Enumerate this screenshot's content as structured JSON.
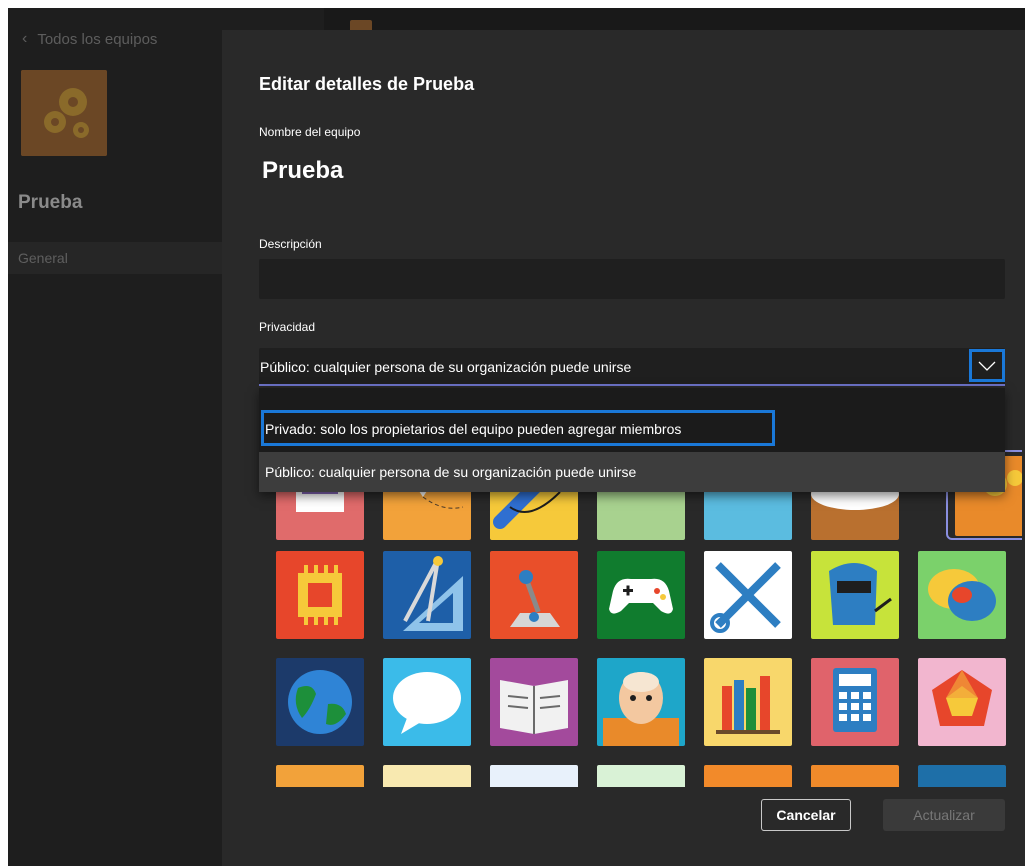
{
  "sidebar": {
    "back_label": "Todos los equipos",
    "team_name": "Prueba",
    "channels": [
      {
        "label": "General"
      }
    ]
  },
  "dialog": {
    "title": "Editar detalles de Prueba",
    "name_label": "Nombre del equipo",
    "team_name": "Prueba",
    "description_label": "Descripción",
    "description_value": "",
    "privacy_label": "Privacidad",
    "privacy_selected": "Público: cualquier persona de su organización puede unirse",
    "privacy_options": [
      {
        "label": "Privado: solo los propietarios del equipo pueden agregar miembros"
      },
      {
        "label": "Público: cualquier persona de su organización puede unirse"
      }
    ],
    "cancel_label": "Cancelar",
    "update_label": "Actualizar"
  },
  "icons": {
    "row1": [
      "photo-frame-icon",
      "paper-plane-icon",
      "link-icon",
      "music-note-icon",
      "art-palette-icon",
      "rocket-launch-icon",
      "gears-icon"
    ],
    "row2": [
      "circuit-chip-icon",
      "compass-ruler-icon",
      "joystick-icon",
      "game-controller-icon",
      "tools-icon",
      "welding-mask-icon",
      "chat-bubbles-icon"
    ],
    "row3": [
      "globe-icon",
      "speech-bubble-icon",
      "open-book-icon",
      "shakespeare-icon",
      "books-shelf-icon",
      "calculator-icon",
      "dodecahedron-icon"
    ]
  },
  "colors": {
    "accent": "#1a78d8",
    "selection": "#6d73c8",
    "dialog_bg": "#292929"
  }
}
